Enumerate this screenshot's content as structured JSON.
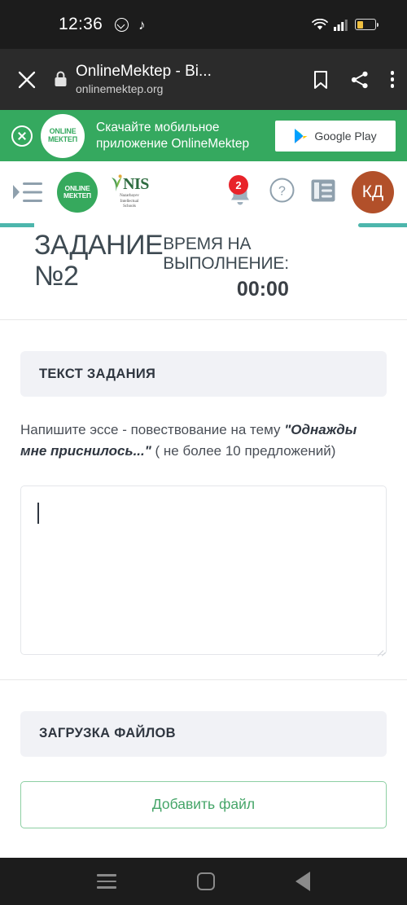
{
  "statusbar": {
    "time": "12:36",
    "icons": [
      "whatsapp-icon",
      "tiktok-icon",
      "wifi-icon",
      "cellular-signal-icon",
      "battery-icon"
    ],
    "battery_level_pct": 38
  },
  "browser": {
    "close_label": "×",
    "page_title": "OnlineMektep - Bi...",
    "url": "onlinemektep.org",
    "icons": [
      "lock-icon",
      "bookmark-icon",
      "share-icon",
      "overflow-menu-icon"
    ]
  },
  "app_banner": {
    "logo_line1": "ONLINE",
    "logo_line2": "МЕКТЕП",
    "text_line1": "Скачайте мобильное",
    "text_line2": "приложение OnlineMektep",
    "store_button": "Google Play",
    "bg_color": "#35a95f"
  },
  "site_header": {
    "logo_line1": "ONLINE",
    "logo_line2": "МЕКТЕП",
    "nis_name": "NIS",
    "nis_sub_line1": "Nazarbayev",
    "nis_sub_line2": "Intellectual",
    "nis_sub_line3": "Schools",
    "notification_count": "2",
    "avatar_initials": "КД",
    "avatar_color": "#b2502a",
    "badge_color": "#e8232a"
  },
  "task": {
    "title_line1": "ЗАДАНИЕ",
    "title_line2": "№2",
    "timer_label_line1": "ВРЕМЯ НА",
    "timer_label_line2": "ВЫПОЛНЕНИЕ:",
    "timer_value": "00:00"
  },
  "task_text_section": {
    "heading": "ТЕКСТ ЗАДАНИЯ",
    "body_prefix": "Напишите эссе - повествование на тему ",
    "body_emphasis": "\"Однажды мне приснилось...\"",
    "body_suffix": " ( не более 10 предложений)",
    "answer_value": "",
    "answer_placeholder": ""
  },
  "files_section": {
    "heading": "ЗАГРУЗКА ФАЙЛОВ",
    "add_file_button": "Добавить файл",
    "accent_color": "#45a568"
  },
  "android_nav": {
    "recents": "recents-icon",
    "home": "home-icon",
    "back": "back-icon"
  }
}
